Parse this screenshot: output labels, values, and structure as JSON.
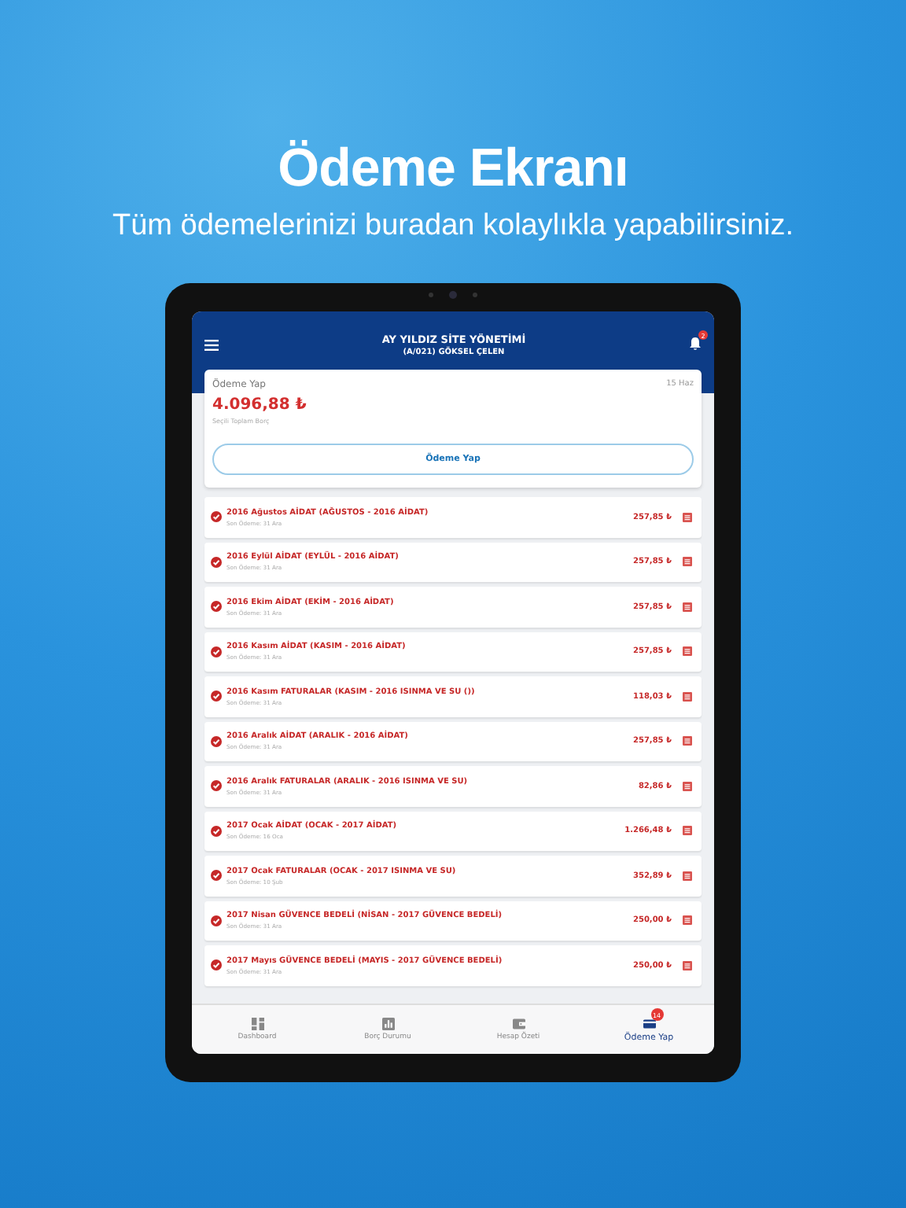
{
  "headline": "Ödeme Ekranı",
  "subheadline": "Tüm ödemelerinizi buradan kolaylıkla yapabilirsiniz.",
  "app_bar": {
    "title": "AY YILDIZ SİTE YÖNETİMİ",
    "subtitle": "(A/021) GÖKSEL ÇELEN",
    "notification_badge": "2"
  },
  "summary_card": {
    "title": "Ödeme Yap",
    "date": "15 Haz",
    "amount": "4.096,88 ₺",
    "amount_label": "Seçili Toplam Borç",
    "button": "Ödeme Yap"
  },
  "debts": [
    {
      "title": "2016 Ağustos AİDAT (AĞUSTOS - 2016 AİDAT)",
      "due": "Son Ödeme: 31 Ara",
      "amount": "257,85 ₺",
      "checked": true
    },
    {
      "title": "2016 Eylül AİDAT (EYLÜL - 2016 AİDAT)",
      "due": "Son Ödeme: 31 Ara",
      "amount": "257,85 ₺",
      "checked": true
    },
    {
      "title": "2016 Ekim AİDAT (EKİM - 2016 AİDAT)",
      "due": "Son Ödeme: 31 Ara",
      "amount": "257,85 ₺",
      "checked": true
    },
    {
      "title": "2016 Kasım AİDAT (KASIM - 2016 AİDAT)",
      "due": "Son Ödeme: 31 Ara",
      "amount": "257,85 ₺",
      "checked": true
    },
    {
      "title": "2016 Kasım FATURALAR (KASIM - 2016 ISINMA VE SU ())",
      "due": "Son Ödeme: 31 Ara",
      "amount": "118,03 ₺",
      "checked": true
    },
    {
      "title": "2016 Aralık AİDAT (ARALIK - 2016 AİDAT)",
      "due": "Son Ödeme: 31 Ara",
      "amount": "257,85 ₺",
      "checked": true
    },
    {
      "title": "2016 Aralık FATURALAR (ARALIK - 2016 ISINMA VE SU)",
      "due": "Son Ödeme: 31 Ara",
      "amount": "82,86 ₺",
      "checked": true
    },
    {
      "title": "2017 Ocak AİDAT (OCAK - 2017 AİDAT)",
      "due": "Son Ödeme: 16 Oca",
      "amount": "1.266,48 ₺",
      "checked": true
    },
    {
      "title": "2017 Ocak FATURALAR (OCAK - 2017 ISINMA VE SU)",
      "due": "Son Ödeme: 10 Şub",
      "amount": "352,89 ₺",
      "checked": true
    },
    {
      "title": "2017 Nisan GÜVENCE BEDELİ (NİSAN - 2017 GÜVENCE BEDELİ)",
      "due": "Son Ödeme: 31 Ara",
      "amount": "250,00 ₺",
      "checked": true
    },
    {
      "title": "2017 Mayıs GÜVENCE BEDELİ (MAYIS - 2017 GÜVENCE BEDELİ)",
      "due": "Son Ödeme: 31 Ara",
      "amount": "250,00 ₺",
      "checked": true
    }
  ],
  "bottom_nav": [
    {
      "kind": "dashboard",
      "label": "Dashboard",
      "selected": false
    },
    {
      "kind": "debt",
      "label": "Borç Durumu",
      "selected": false
    },
    {
      "kind": "statement",
      "label": "Hesap Özeti",
      "selected": false
    },
    {
      "kind": "payment",
      "label": "Ödeme Yap",
      "selected": true,
      "badge": "14"
    }
  ]
}
